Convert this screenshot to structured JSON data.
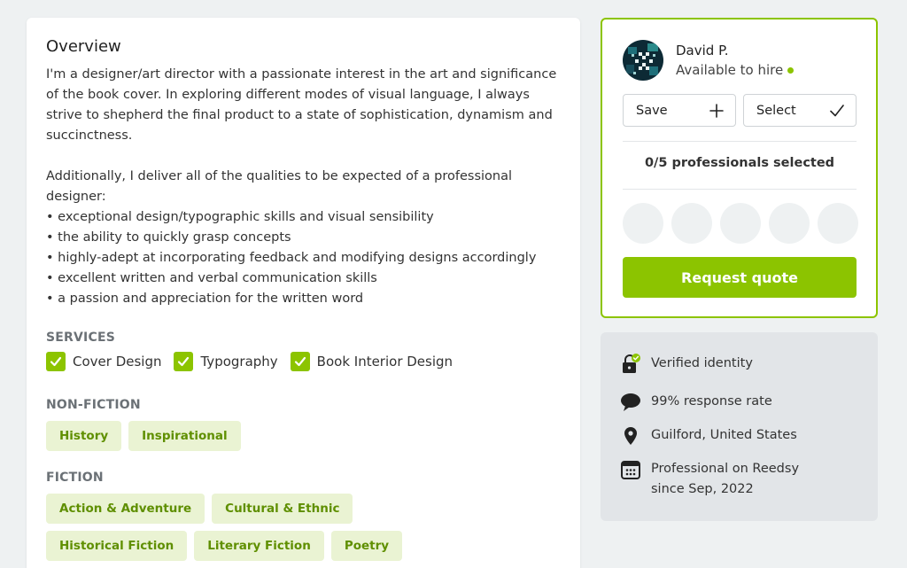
{
  "overview": {
    "title": "Overview",
    "bio": [
      "I'm a designer/art director with a passionate interest in the art and significance of the book cover. In exploring different modes of visual language, I always strive to shepherd the final product to a state of sophistication, dynamism and succinctness.",
      "Additionally, I deliver all of the qualities to be expected of a professional designer:",
      "• exceptional design/typographic skills and visual sensibility",
      "• the ability to quickly grasp concepts",
      "• highly-adept at incorporating feedback and modifying designs accordingly",
      "• excellent written and verbal communication skills",
      "• a passion and appreciation for the written word"
    ],
    "services_label": "SERVICES",
    "services": [
      "Cover Design",
      "Typography",
      "Book Interior Design"
    ],
    "nonfiction_label": "NON-FICTION",
    "nonfiction_tags": [
      "History",
      "Inspirational"
    ],
    "fiction_label": "FICTION",
    "fiction_tags": [
      "Action & Adventure",
      "Cultural & Ethnic",
      "Historical Fiction",
      "Literary Fiction",
      "Poetry"
    ]
  },
  "hire_card": {
    "name": "David P.",
    "availability": "Available to hire",
    "save_label": "Save",
    "select_label": "Select",
    "selected_count": "0/5 professionals selected",
    "request_label": "Request quote"
  },
  "info": {
    "verified": "Verified identity",
    "response_rate": "99% response rate",
    "location": "Guilford, United States",
    "professional_line1": "Professional on Reedsy",
    "professional_line2": "since Sep, 2022"
  },
  "colors": {
    "accent": "#8cc400",
    "tag_bg": "#eaf3d3",
    "tag_text": "#5f8f00",
    "page_bg": "#eef1f2",
    "info_bg": "#e2e5e8"
  },
  "icons": {
    "save": "plus-icon",
    "select": "checkmark-icon",
    "verified": "lock-check-icon",
    "response": "speech-bubble-icon",
    "location": "map-pin-icon",
    "professional": "calendar-icon",
    "service_check": "checkbox-checked-icon"
  }
}
